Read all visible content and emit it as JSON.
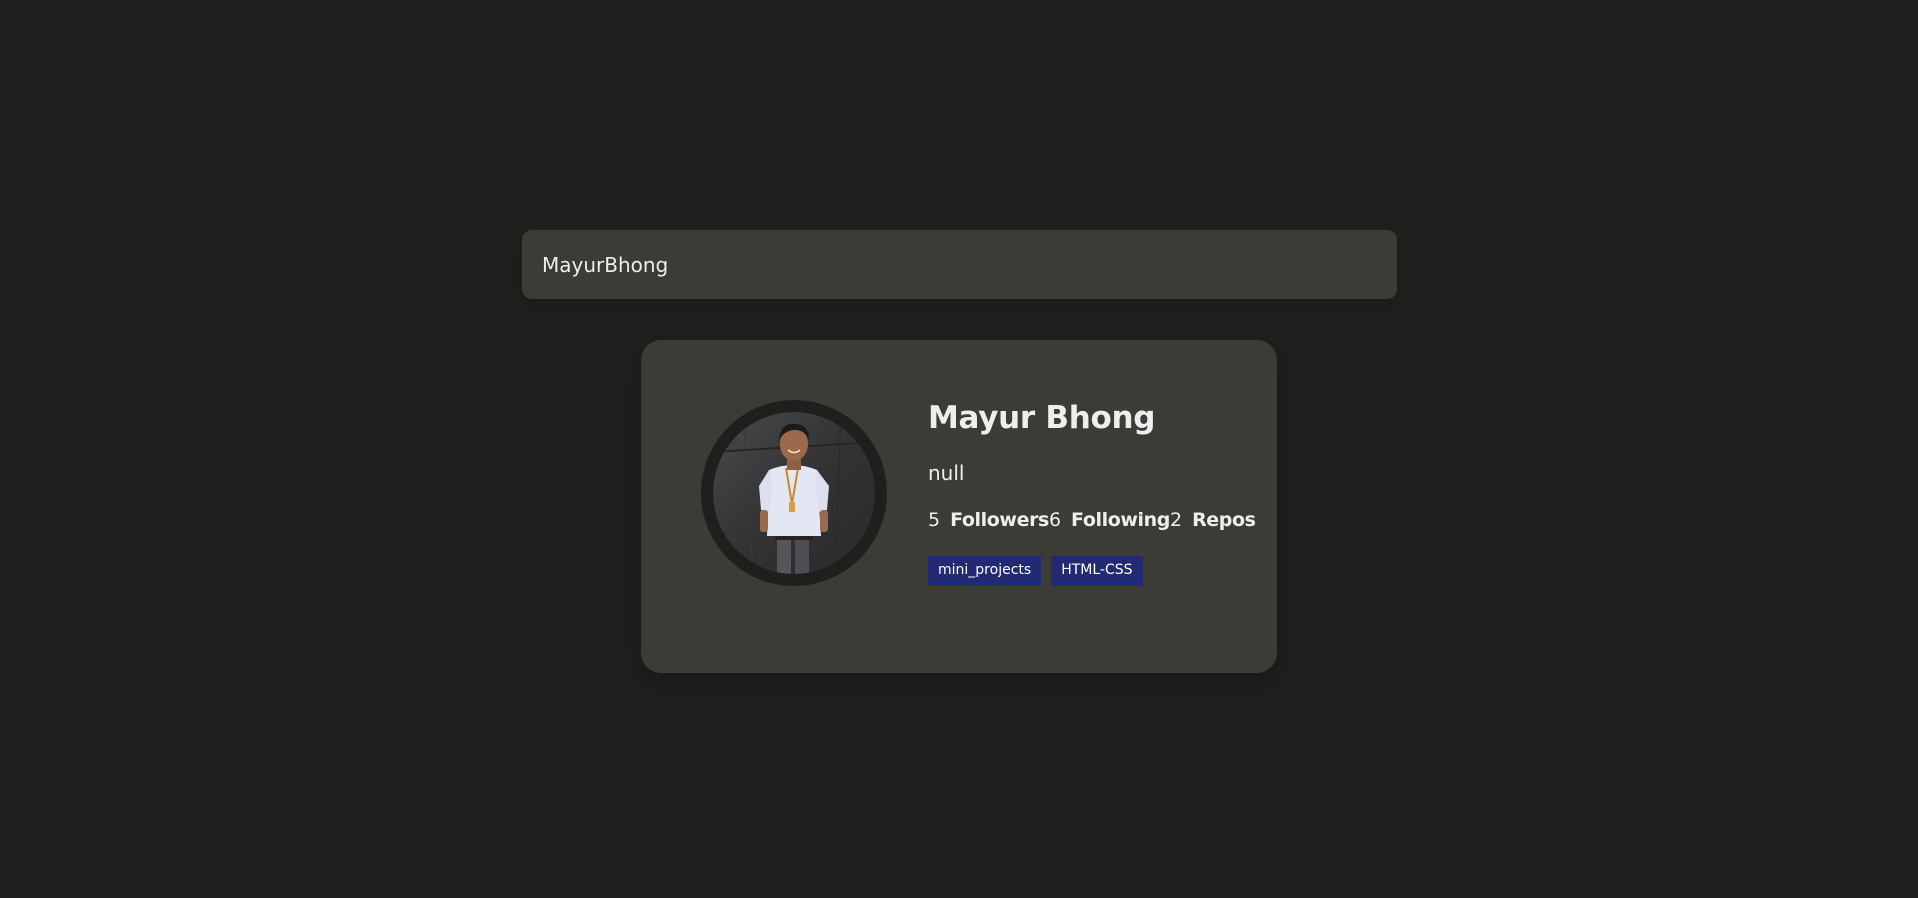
{
  "search": {
    "value": "MayurBhong"
  },
  "profile": {
    "name": "Mayur Bhong",
    "bio": "null",
    "stats": [
      {
        "value": "5",
        "label": "Followers"
      },
      {
        "value": "6",
        "label": "Following"
      },
      {
        "value": "2",
        "label": "Repos"
      }
    ],
    "repos": [
      "mini_projects",
      "HTML-CSS"
    ]
  },
  "colors": {
    "background": "#1f201e",
    "card": "#3c3c36",
    "repo_badge": "#212a72",
    "text": "#eeeeee"
  }
}
